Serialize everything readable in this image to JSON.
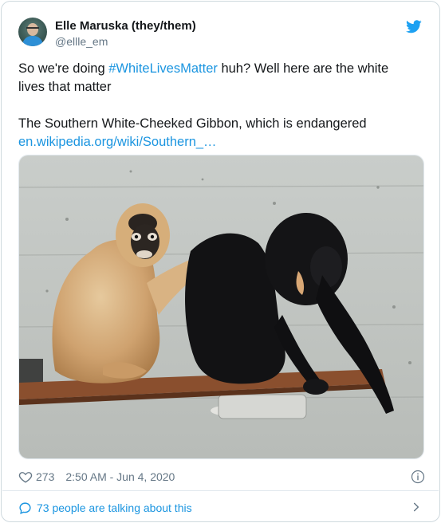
{
  "tweet": {
    "author": {
      "display_name": "Elle Maruska (they/them)",
      "handle": "@ellle_em",
      "avatar": "avatar-photo"
    },
    "body": {
      "line1_prefix": "So we're doing ",
      "hashtag": "#WhiteLivesMatter",
      "line1_suffix": " huh? Well here are the white lives that matter",
      "line2": "The Southern White-Cheeked Gibbon, which is endangered",
      "link": "en.wikipedia.org/wiki/Southern_…"
    },
    "media": {
      "icon": "photo-of-two-gibbons"
    },
    "meta": {
      "likes": "273",
      "timestamp": "2:50 AM - Jun 4, 2020"
    },
    "footer": {
      "talking_label": "73 people are talking about this"
    }
  },
  "colors": {
    "accent": "#1b95e0",
    "text": "#14171a",
    "secondary": "#657786",
    "border": "#e1e8ed"
  },
  "icons": {
    "brand": "twitter-bird-icon",
    "like": "heart-icon",
    "info": "info-icon",
    "chat": "chat-bubble-icon",
    "chevron": "chevron-right-icon"
  }
}
